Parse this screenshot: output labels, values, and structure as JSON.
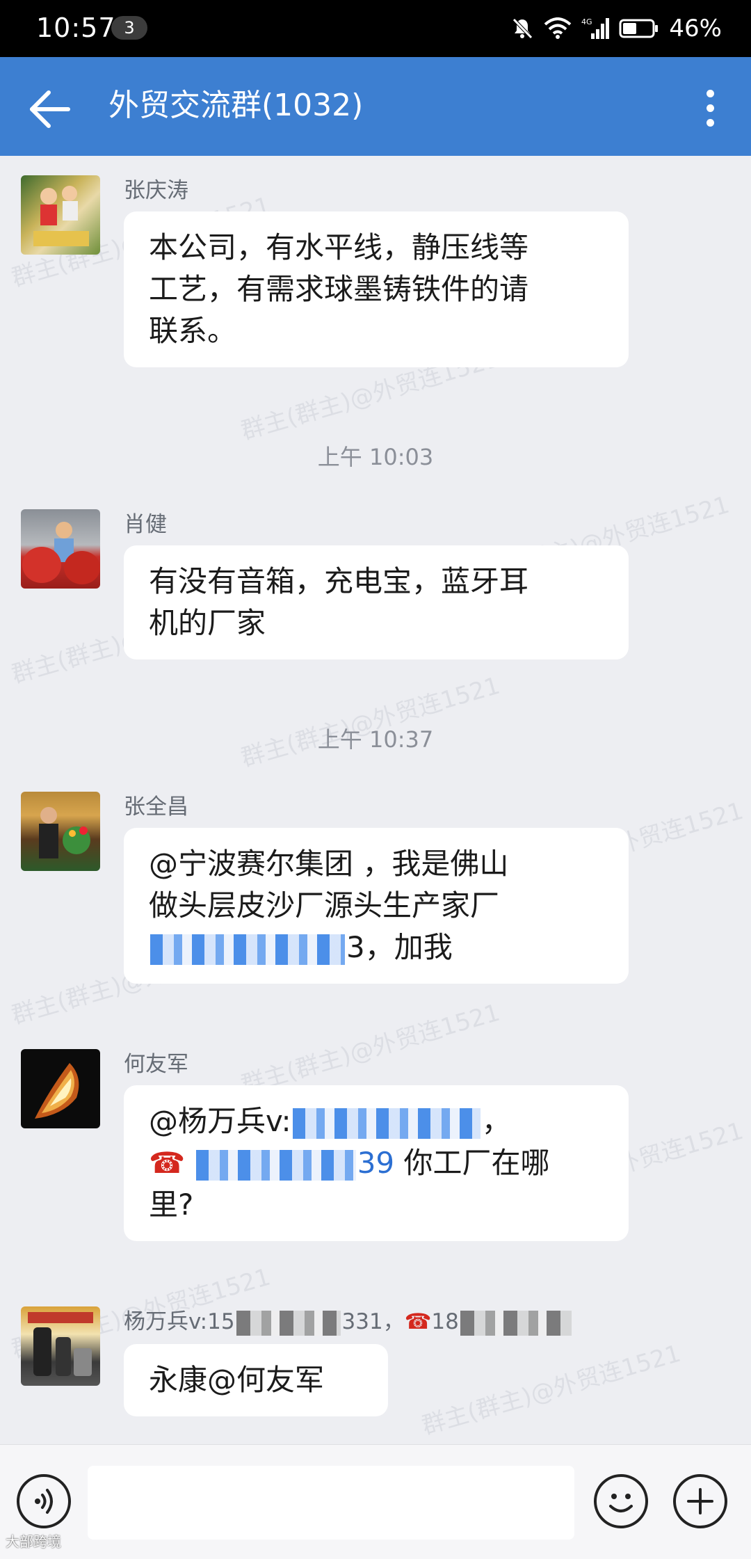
{
  "status_bar": {
    "time": "10:57",
    "notification_count": "3",
    "network": "4G",
    "battery": "46%"
  },
  "header": {
    "title": "外贸交流群(1032)"
  },
  "watermark_text": "群主(群主)@外贸连1521",
  "messages": [
    {
      "sender": "张庆涛",
      "lines": [
        "本公司，有水平线，静压线等",
        "工艺，有需求球墨铸铁件的请",
        "联系。"
      ]
    },
    {
      "time": "上午 10:03"
    },
    {
      "sender": "肖健",
      "lines": [
        "有没有音箱，充电宝，蓝牙耳",
        "机的厂家"
      ]
    },
    {
      "time": "上午 10:37"
    },
    {
      "sender": "张全昌",
      "lines": [
        "@宁波赛尔集团 ，我是佛山",
        "做头层皮沙厂源头生产家厂",
        "3，加我"
      ]
    },
    {
      "sender": "何友军",
      "line1": "@杨万兵v:",
      "line1_end": "，",
      "phone_end": "39",
      "line2_text": "你工厂在哪",
      "line3": "里?"
    },
    {
      "sender_prefix": "杨万兵v:15",
      "sender_mid": "331，",
      "sender_phone_prefix": "18",
      "lines": [
        "永康@何友军"
      ]
    }
  ],
  "footer_watermark": "大部跨境"
}
